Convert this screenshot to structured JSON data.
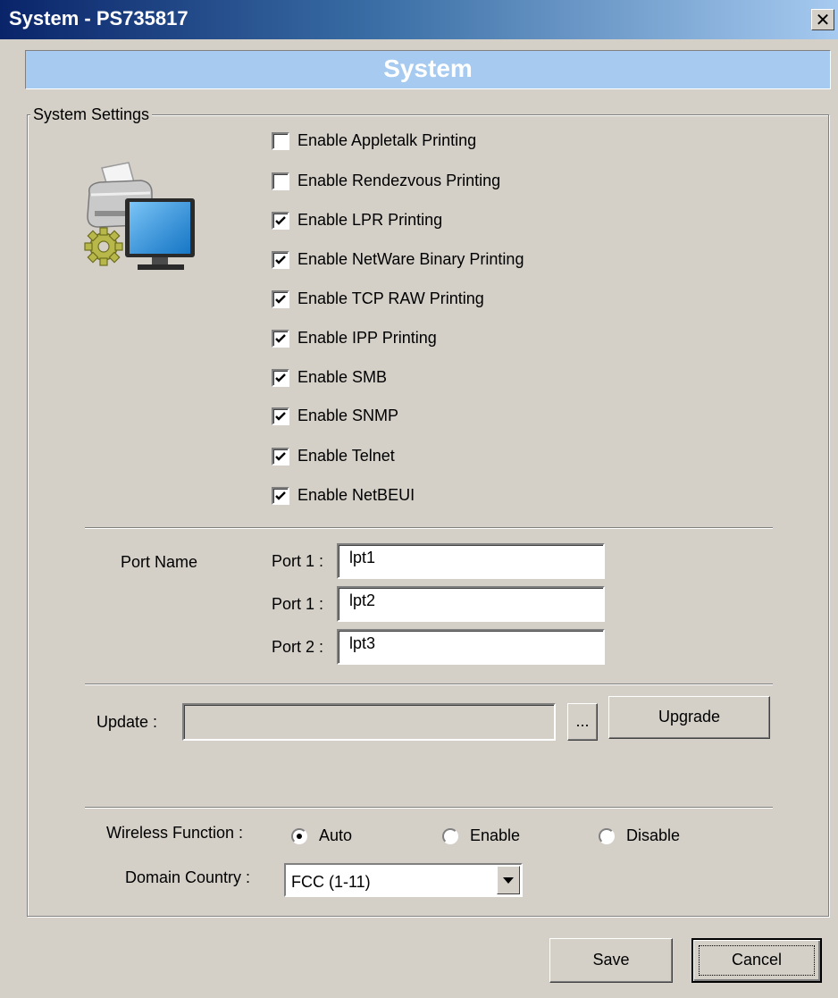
{
  "window": {
    "title": "System - PS735817"
  },
  "banner": {
    "title": "System"
  },
  "settings": {
    "legend": "System Settings",
    "checkboxes": [
      {
        "label": "Enable Appletalk Printing",
        "checked": false
      },
      {
        "label": "Enable Rendezvous Printing",
        "checked": false
      },
      {
        "label": "Enable LPR Printing",
        "checked": true
      },
      {
        "label": "Enable NetWare Binary Printing",
        "checked": true
      },
      {
        "label": "Enable TCP RAW Printing",
        "checked": true
      },
      {
        "label": "Enable IPP Printing",
        "checked": true
      },
      {
        "label": "Enable SMB",
        "checked": true
      },
      {
        "label": "Enable SNMP",
        "checked": true
      },
      {
        "label": "Enable Telnet",
        "checked": true
      },
      {
        "label": "Enable NetBEUI",
        "checked": true
      }
    ]
  },
  "ports": {
    "section_label": "Port Name",
    "rows": [
      {
        "label": "Port 1 :",
        "value": "lpt1"
      },
      {
        "label": "Port 1 :",
        "value": "lpt2"
      },
      {
        "label": "Port 2 :",
        "value": "lpt3"
      }
    ]
  },
  "update": {
    "label": "Update :",
    "value": "",
    "browse_label": "...",
    "upgrade_label": "Upgrade"
  },
  "wireless": {
    "label": "Wireless Function :",
    "options": [
      {
        "label": "Auto",
        "selected": true
      },
      {
        "label": "Enable",
        "selected": false
      },
      {
        "label": "Disable",
        "selected": false
      }
    ]
  },
  "domain": {
    "label": "Domain Country :",
    "value": "FCC (1-11)"
  },
  "footer": {
    "save_label": "Save",
    "cancel_label": "Cancel"
  },
  "icons": {
    "close": "close-icon",
    "printer": "printer-computer-icon",
    "dropdown": "chevron-down-icon"
  }
}
